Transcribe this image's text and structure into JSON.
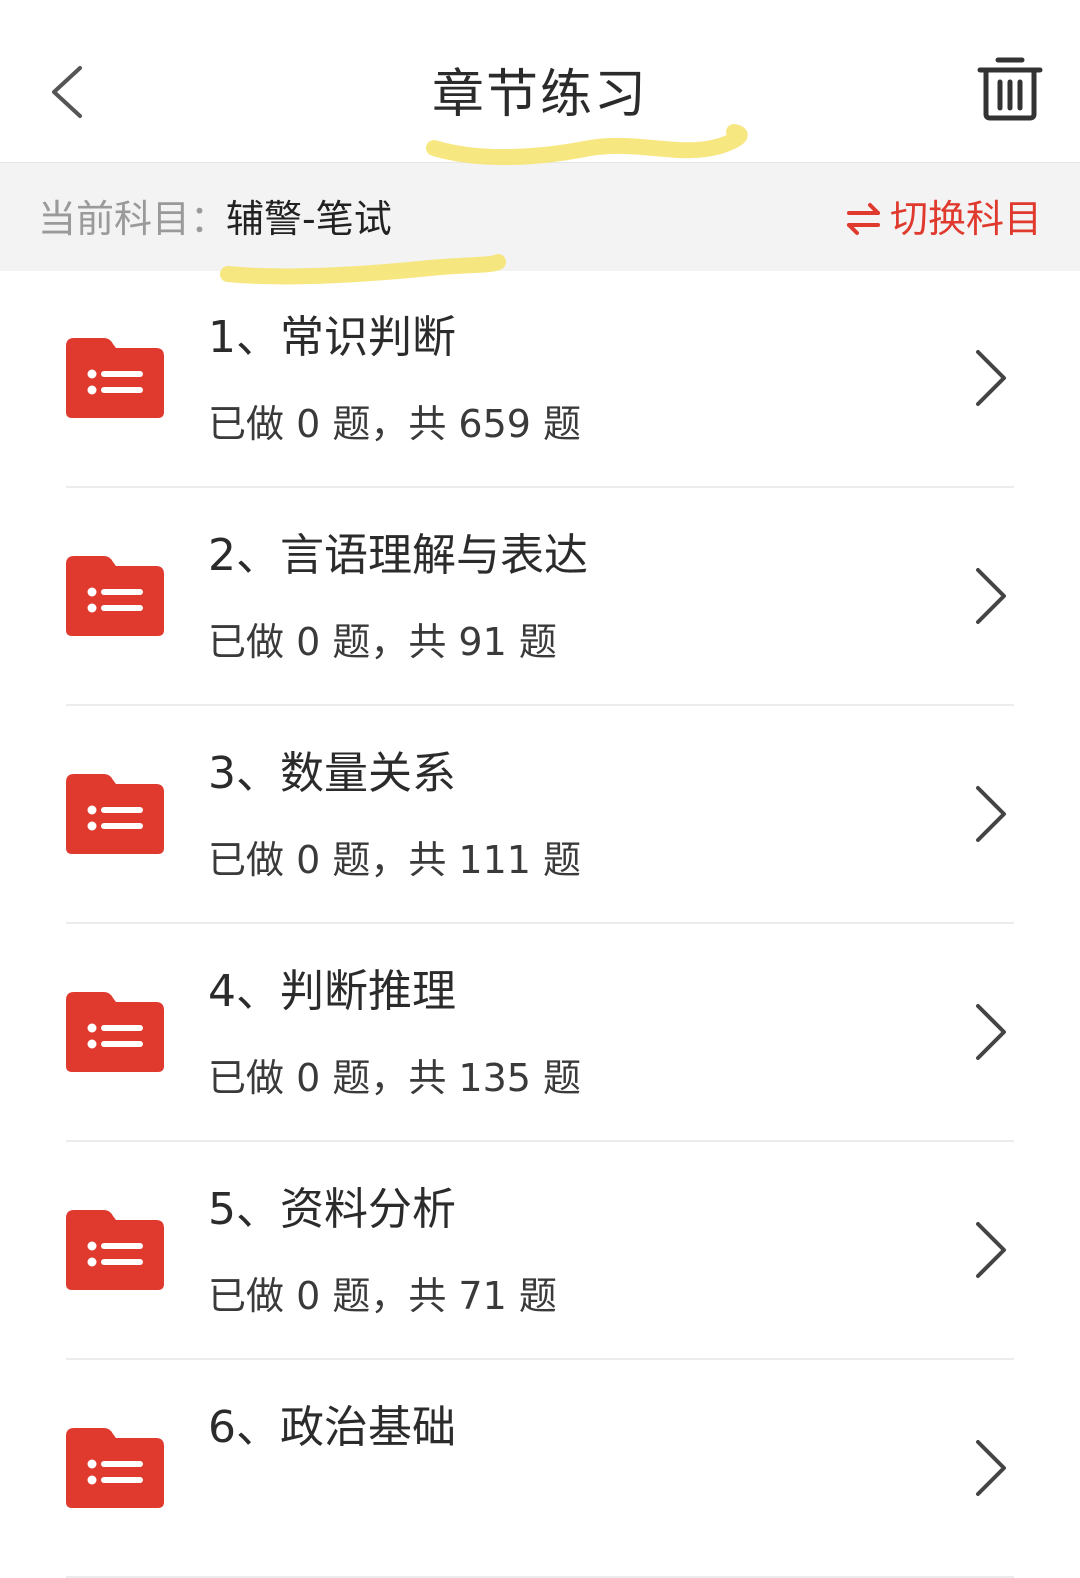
{
  "header": {
    "title": "章节练习",
    "back_icon": "chevron-left-icon",
    "trash_icon": "trash-icon"
  },
  "subject_bar": {
    "label": "当前科目：",
    "value": "辅警-笔试",
    "switch_label": "切换科目",
    "switch_icon": "swap-arrows-icon"
  },
  "colors": {
    "accent": "#e03a2f",
    "highlight": "#f6e36b",
    "subject_bar_bg": "#f3f3f3"
  },
  "chapters": [
    {
      "title": "1、常识判断",
      "progress": "已做 0 题，共 659 题"
    },
    {
      "title": "2、言语理解与表达",
      "progress": "已做 0 题，共 91 题"
    },
    {
      "title": "3、数量关系",
      "progress": "已做 0 题，共 111 题"
    },
    {
      "title": "4、判断推理",
      "progress": "已做 0 题，共 135 题"
    },
    {
      "title": "5、资料分析",
      "progress": "已做 0 题，共 71 题"
    },
    {
      "title": "6、政治基础",
      "progress": ""
    }
  ]
}
